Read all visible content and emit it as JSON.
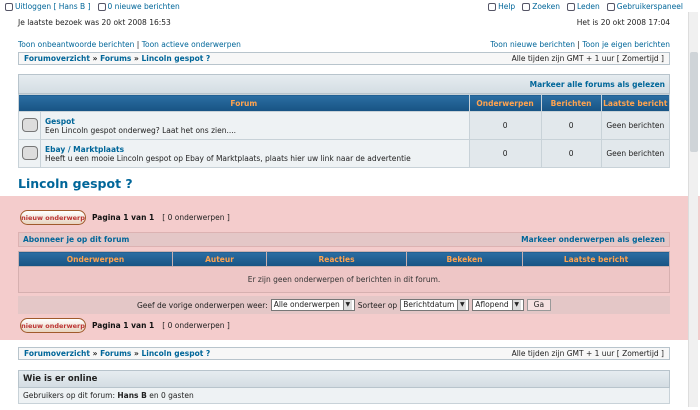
{
  "top": {
    "logout": "Uitloggen [ Hans B ]",
    "new_posts": "0 nieuwe berichten",
    "help": "Help",
    "search": "Zoeken",
    "members": "Leden",
    "usercp": "Gebruikerspaneel"
  },
  "info": {
    "last_visit": "Je laatste bezoek was 20 okt 2008 16:53",
    "current_time": "Het is 20 okt 2008 17:04"
  },
  "links": {
    "unanswered": "Toon onbeantwoorde berichten",
    "active": "Toon actieve onderwerpen",
    "new_posts": "Toon nieuwe berichten",
    "your_posts": "Toon je eigen berichten"
  },
  "breadcrumb": {
    "index": "Forumoverzicht",
    "forums": "Forums",
    "current": "Lincoln gespot ?",
    "sep": "»",
    "timezone": "Alle tijden zijn GMT + 1 uur [ Zomertijd ]"
  },
  "mark_all": "Markeer alle forums als gelezen",
  "forum_table": {
    "headers": [
      "Forum",
      "Onderwerpen",
      "Berichten",
      "Laatste bericht"
    ],
    "rows": [
      {
        "title": "Gespot",
        "desc": "Een Lincoln gespot onderweg? Laat het ons zien....",
        "topics": "0",
        "posts": "0",
        "last": "Geen berichten"
      },
      {
        "title": "Ebay / Marktplaats",
        "desc": "Heeft u een mooie Lincoln gespot op Ebay of Marktplaats, plaats hier uw link naar de advertentie",
        "topics": "0",
        "posts": "0",
        "last": "Geen berichten"
      }
    ]
  },
  "page_title": "Lincoln gespot ?",
  "new_topic_button": "nieuw onderwerp",
  "pagination": {
    "label": "Pagina 1 van 1",
    "count": "[ 0 onderwerpen ]"
  },
  "subscribe": "Abonneer je op dit forum",
  "mark_topics": "Markeer onderwerpen als gelezen",
  "topic_table": {
    "headers": [
      "Onderwerpen",
      "Auteur",
      "Reacties",
      "Bekeken",
      "Laatste bericht"
    ],
    "empty_message": "Er zijn geen onderwerpen of berichten in dit forum."
  },
  "filter": {
    "label_show": "Geef de vorige onderwerpen weer:",
    "show_value": "Alle onderwerpen",
    "label_sort": "Sorteer op",
    "sort_value": "Berichtdatum",
    "order_value": "Aflopend",
    "go": "Ga"
  },
  "online": {
    "heading": "Wie is er online",
    "text_prefix": "Gebruikers op dit forum:",
    "user": "Hans B",
    "text_suffix": "en 0 gasten"
  }
}
